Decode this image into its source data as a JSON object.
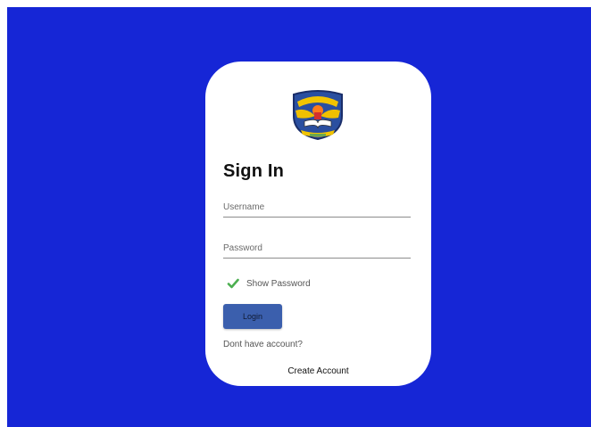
{
  "login": {
    "title": "Sign In",
    "username_placeholder": "Username",
    "password_placeholder": "Password",
    "show_password_label": "Show Password",
    "show_password_checked": true,
    "login_label": "Login",
    "no_account_text": "Dont have account?",
    "create_account_label": "Create Account",
    "logo_icon": "school-crest-logo"
  },
  "colors": {
    "background": "#1626d6",
    "card": "#ffffff",
    "button": "#3b5fad",
    "check": "#4caf50"
  }
}
